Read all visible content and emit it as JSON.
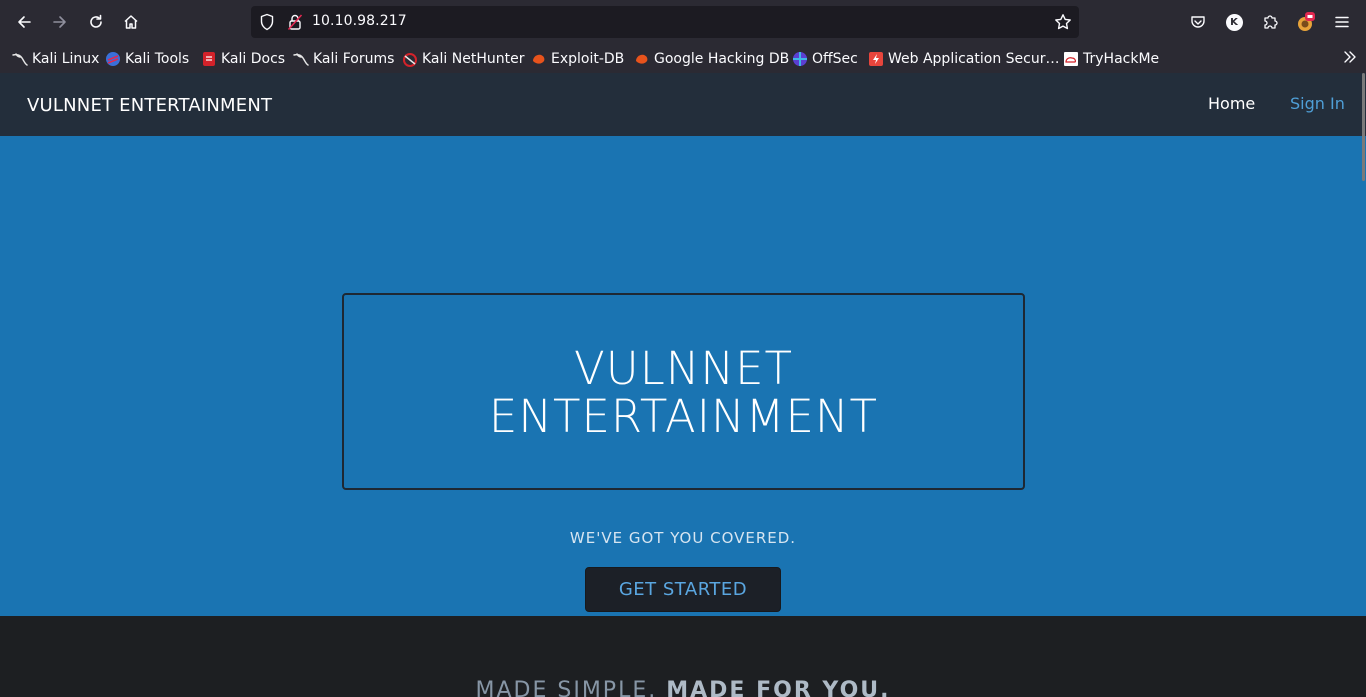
{
  "browser": {
    "url": "10.10.98.217",
    "bookmarks": [
      {
        "label": "Kali Linux",
        "icon": "kali-dragon-icon"
      },
      {
        "label": "Kali Tools",
        "icon": "kali-tools-icon"
      },
      {
        "label": "Kali Docs",
        "icon": "kali-docs-icon"
      },
      {
        "label": "Kali Forums",
        "icon": "kali-dragon-icon"
      },
      {
        "label": "Kali NetHunter",
        "icon": "nethunter-icon"
      },
      {
        "label": "Exploit-DB",
        "icon": "exploit-db-icon"
      },
      {
        "label": "Google Hacking DB",
        "icon": "ghdb-icon"
      },
      {
        "label": "OffSec",
        "icon": "offsec-icon"
      },
      {
        "label": "Web Application Secur…",
        "icon": "portswigger-icon"
      },
      {
        "label": "TryHackMe",
        "icon": "tryhackme-icon"
      }
    ],
    "profile_initial": "K"
  },
  "site": {
    "brand": "VULNNET ENTERTAINMENT",
    "nav": {
      "home": "Home",
      "signin": "Sign In"
    },
    "hero": {
      "title_line1": "VULNNET",
      "title_line2": "ENTERTAINMENT",
      "tagline": "WE'VE GOT YOU COVERED.",
      "cta": "GET STARTED"
    },
    "section2": {
      "part1": "MADE SIMPLE.",
      "part2": "MADE FOR YOU."
    }
  },
  "colors": {
    "chrome_bg": "#2b2a33",
    "urlbar_bg": "#1c1b22",
    "site_nav_bg": "#232e3b",
    "hero_bg": "#1a74b2",
    "accent_link": "#4f9fd7",
    "cta_bg": "#1c2027"
  }
}
